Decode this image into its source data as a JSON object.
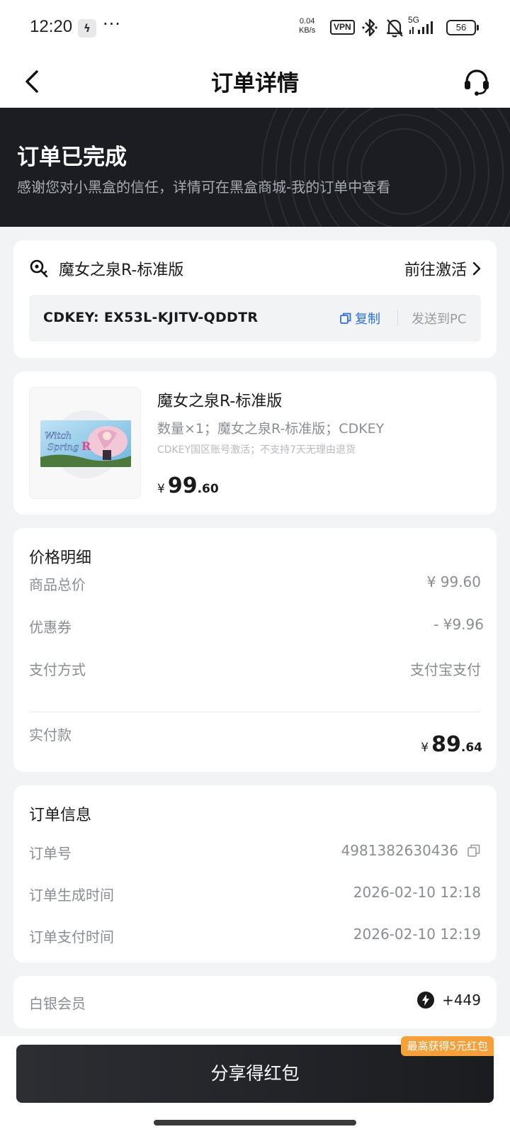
{
  "status_bar": {
    "time": "12:20",
    "app_icon": "ϟ",
    "more": "···",
    "speed_value": "0.04",
    "speed_unit": "KB/s",
    "vpn": "VPN",
    "network": "5G",
    "battery": "56"
  },
  "nav": {
    "title": "订单详情",
    "back_icon": "chevron-left-icon",
    "support_icon": "headset-icon"
  },
  "banner": {
    "title": "订单已完成",
    "subtitle": "感谢您对小黑盒的信任，详情可在黑盒商城-我的订单中查看"
  },
  "activation": {
    "product_name": "魔女之泉R-标准版",
    "activate_label": "前往激活",
    "cdkey": "CDKEY: EX53L-KJITV-QDDTR",
    "copy_label": "复制",
    "send_pc_label": "发送到PC"
  },
  "product": {
    "name": "魔女之泉R-标准版",
    "spec": "数量×1；魔女之泉R-标准版；CDKEY",
    "note": "CDKEY国区账号激活；不支持7天无理由退货",
    "image_text": "Witch Spring R",
    "price_currency": "¥",
    "price_int": "99",
    "price_dec": ".60"
  },
  "price_detail": {
    "title": "价格明细",
    "rows": [
      {
        "label": "商品总价",
        "value": "¥ 99.60"
      },
      {
        "label": "优惠券",
        "value": "- ¥9.96"
      },
      {
        "label": "支付方式",
        "value": "支付宝支付"
      }
    ],
    "paid_label": "实付款",
    "paid_currency": "¥",
    "paid_int": "89",
    "paid_dec": ".64"
  },
  "order_info": {
    "title": "订单信息",
    "order_no_label": "订单号",
    "order_no": "4981382630436",
    "created_label": "订单生成时间",
    "created": "2026-02-10 12:18",
    "paid_label": "订单支付时间",
    "paid": "2026-02-10 12:19"
  },
  "member": {
    "label": "白银会员",
    "points": "+449"
  },
  "bottom": {
    "share_label": "分享得红包",
    "promo_badge": "最高获得5元红包"
  },
  "colors": {
    "banner_bg": "#1b1d22",
    "link_blue": "#2f6fd6",
    "promo_orange": "#f6a03b",
    "page_bg": "#f2f3f5"
  }
}
